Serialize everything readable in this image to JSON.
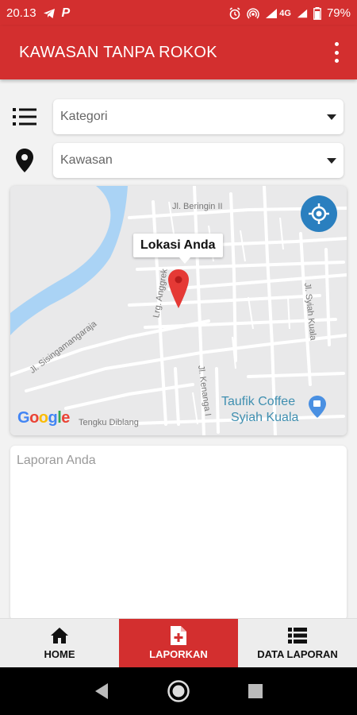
{
  "status_bar": {
    "time": "20.13",
    "network": "4G",
    "battery": "79%"
  },
  "app_bar": {
    "title": "KAWASAN TANPA ROKOK"
  },
  "form": {
    "category_select": {
      "placeholder": "Kategori"
    },
    "area_select": {
      "placeholder": "Kawasan"
    },
    "report_input": {
      "placeholder": "Laporan Anda",
      "value": ""
    }
  },
  "map": {
    "tooltip": "Lokasi Anda",
    "street_labels": [
      "Jl. Beringin II",
      "Lrg. Anggrek",
      "Jl. Syiah Kuala",
      "Jl. Sisingamangaraja",
      "Jl. Kenanga I",
      "Tengku Diblang"
    ],
    "poi": {
      "line1": "Taufik Coffee",
      "line2": "Syiah Kuala"
    },
    "attribution": [
      "G",
      "o",
      "o",
      "g",
      "l",
      "e"
    ],
    "colors": {
      "water": "#aad3f5",
      "road": "#ffffff",
      "land": "#e9e9ea",
      "marker": "#e53935",
      "poi": "#3f8fb0"
    }
  },
  "bottom_nav": {
    "items": [
      {
        "label": "HOME",
        "icon": "home-icon"
      },
      {
        "label": "LAPORKAN",
        "icon": "report-add-icon",
        "active": true
      },
      {
        "label": "DATA LAPORAN",
        "icon": "list-icon"
      }
    ]
  },
  "colors": {
    "primary": "#d32f2f",
    "gps_button": "#2a7fbf",
    "nav_background": "#ededed"
  }
}
